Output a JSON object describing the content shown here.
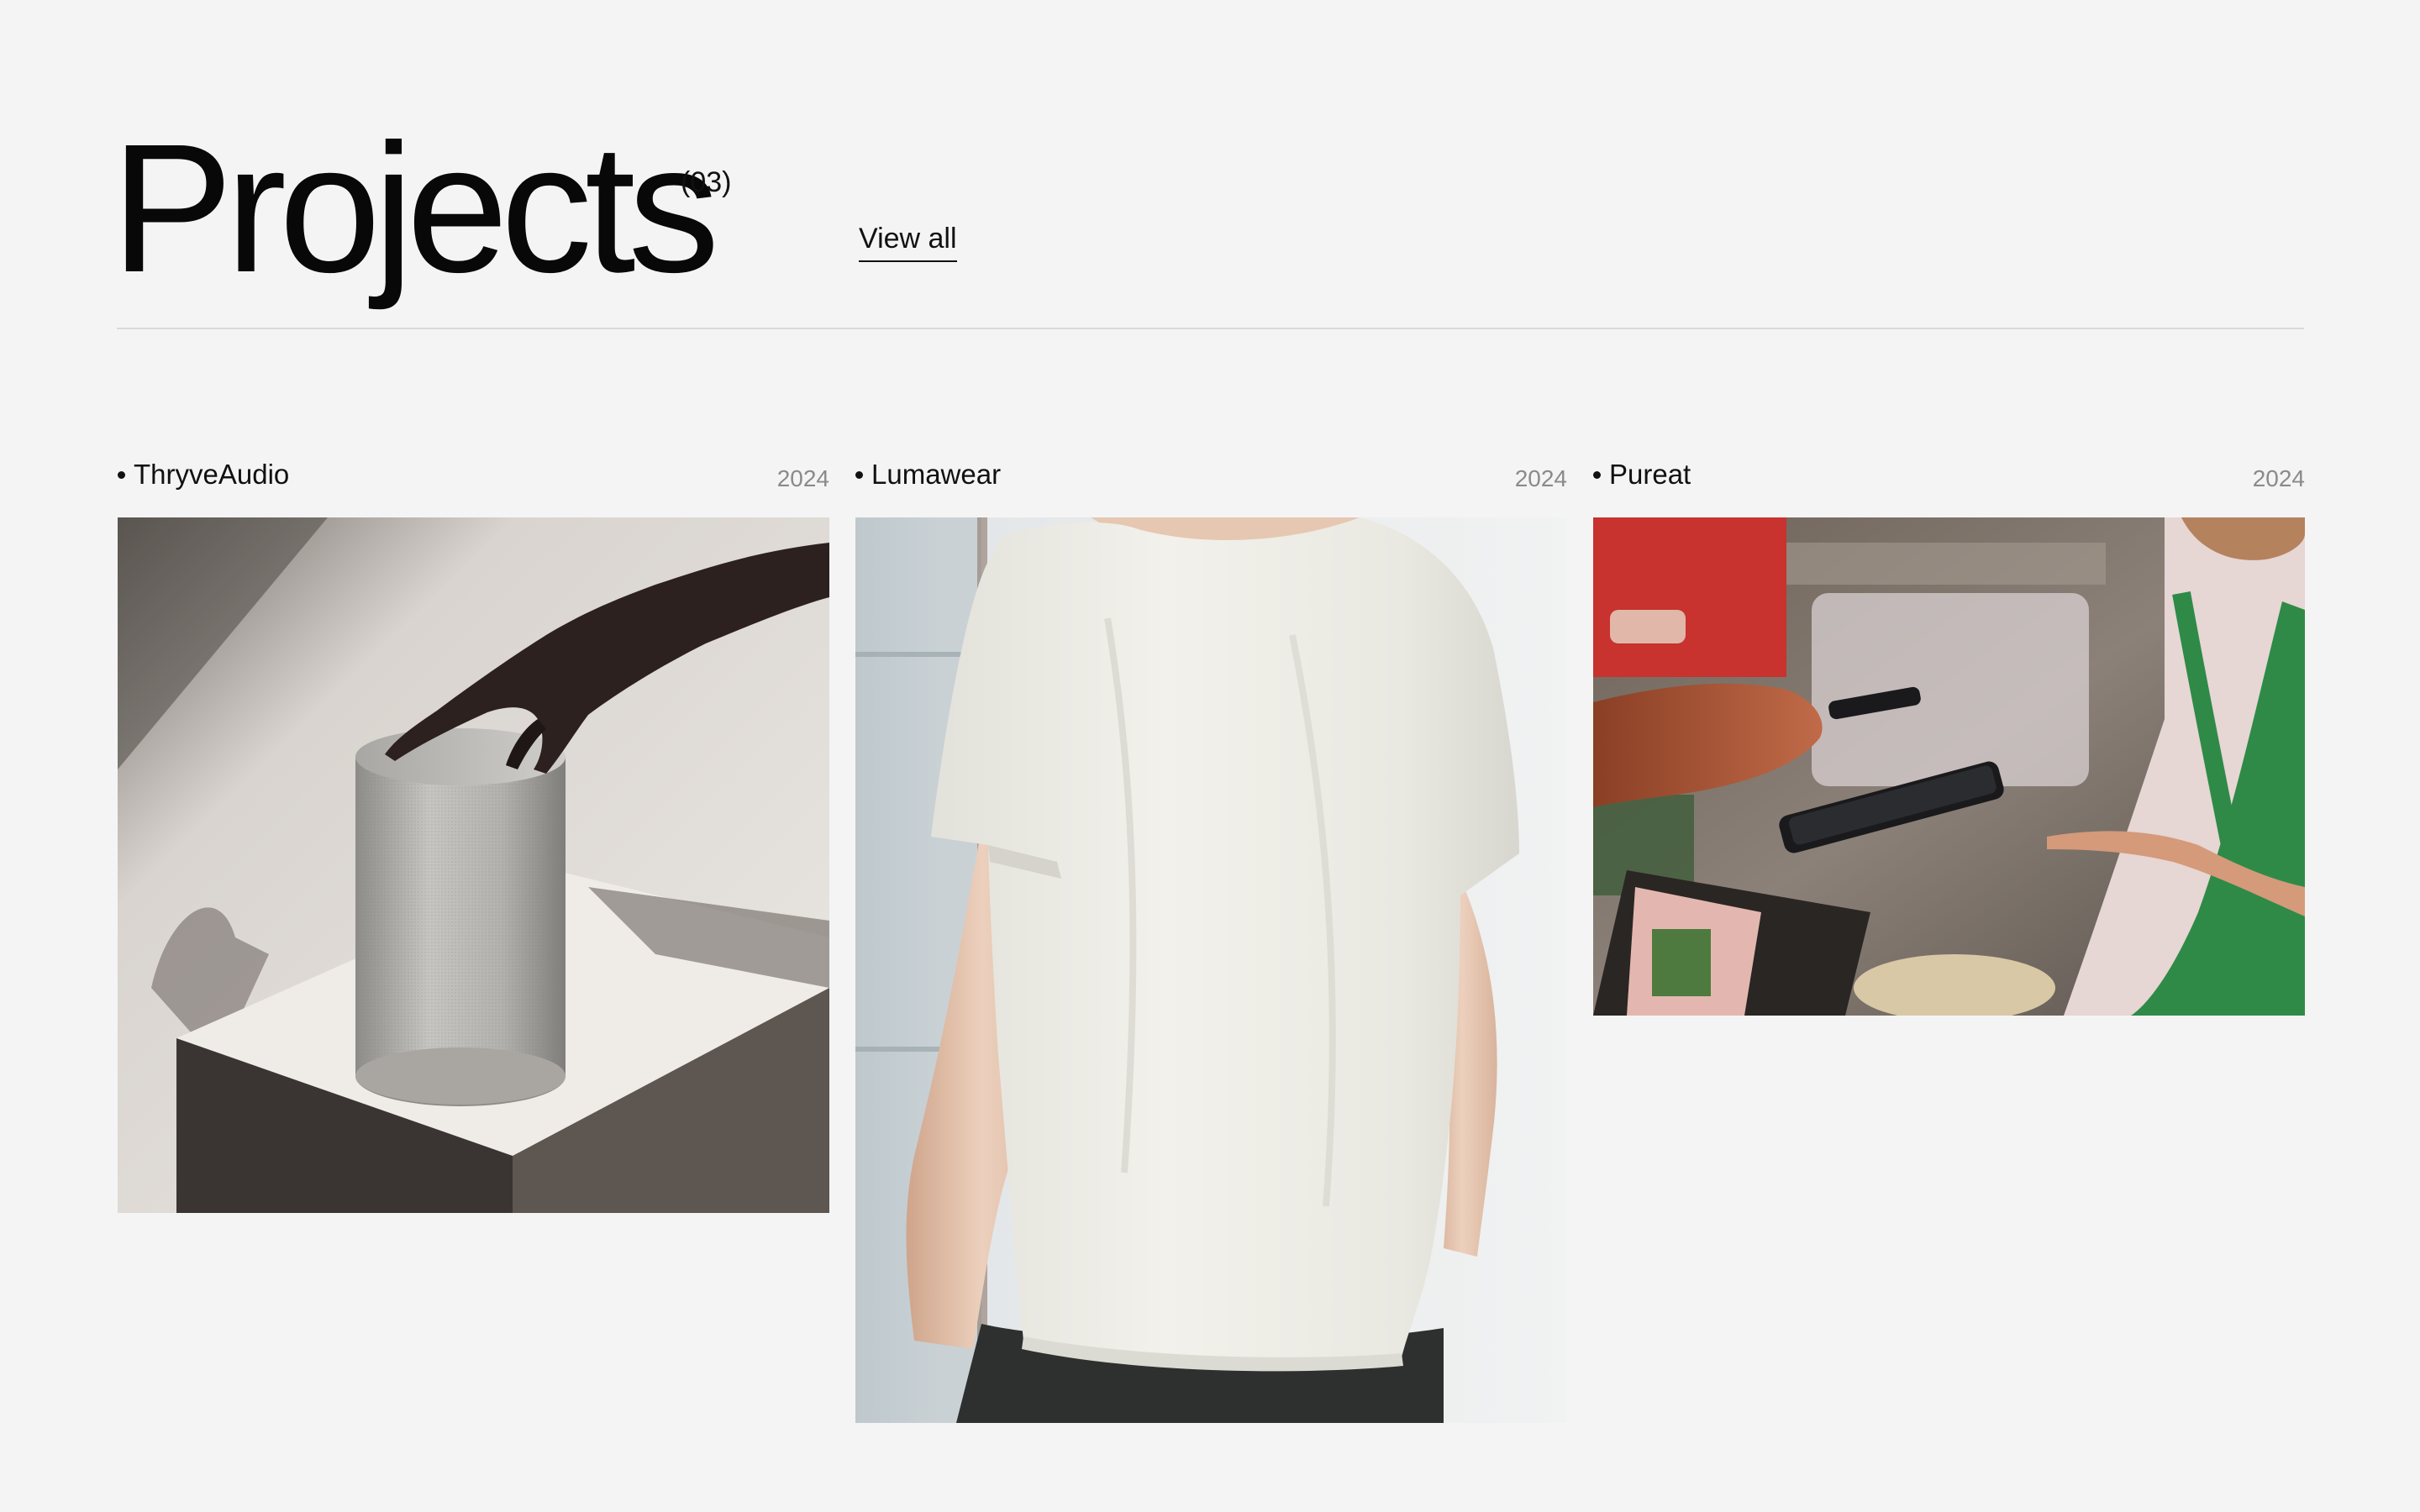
{
  "header": {
    "title": "Projects",
    "count": "(03)",
    "view_all_label": "View all"
  },
  "projects": [
    {
      "name": "ThryveAudio",
      "year": "2024",
      "image_subject": "hand touching a fabric smart speaker on a white pedestal",
      "palette": {
        "background": "#e2deda",
        "shadow": "#5e5854",
        "speaker": "#b9b7b4",
        "hand": "#2d221f"
      }
    },
    {
      "name": "Lumawear",
      "year": "2024",
      "image_subject": "man wearing a plain white t-shirt seen from behind",
      "palette": {
        "background": "#dfe3e5",
        "shirt": "#ecebe4",
        "skin": "#e8c9b4",
        "pants": "#2e3130"
      }
    },
    {
      "name": "Pureat",
      "year": "2024",
      "image_subject": "contactless phone payment at a street food stall",
      "palette": {
        "background": "#7a6c63",
        "apron": "#2f8a48",
        "phone": "#1a1a1c",
        "sign": "#c8322f"
      }
    }
  ]
}
